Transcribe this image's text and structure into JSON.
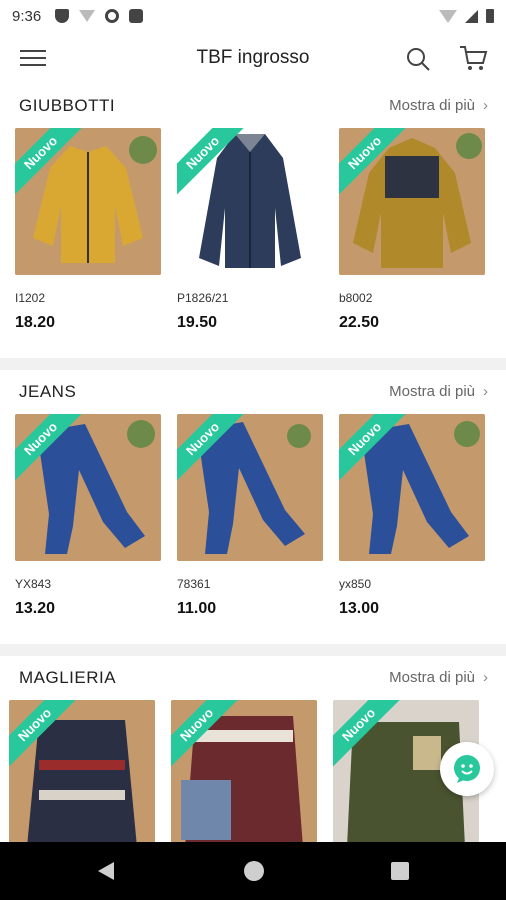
{
  "status_bar": {
    "time": "9:36"
  },
  "app_bar": {
    "title": "TBF ingrosso"
  },
  "sections": [
    {
      "title": "GIUBBOTTI",
      "more_label": "Mostra di più",
      "products": [
        {
          "badge": "Nuovo",
          "sku": "I1202",
          "price": "18.20",
          "color": "#d9a833",
          "bg": "#c49a6c"
        },
        {
          "badge": "Nuovo",
          "sku": "P1826/21",
          "price": "19.50",
          "color": "#2d3c5a",
          "bg": "#ffffff"
        },
        {
          "badge": "Nuovo",
          "sku": "b8002",
          "price": "22.50",
          "color": "#b08a2a",
          "bg": "#c49a6c"
        }
      ]
    },
    {
      "title": "JEANS",
      "more_label": "Mostra di più",
      "products": [
        {
          "badge": "Nuovo",
          "sku": "YX843",
          "price": "13.20",
          "color": "#2c4f9a",
          "bg": "#c49a6c"
        },
        {
          "badge": "Nuovo",
          "sku": "78361",
          "price": "11.00",
          "color": "#2c4f9a",
          "bg": "#c49a6c"
        },
        {
          "badge": "Nuovo",
          "sku": "yx850",
          "price": "13.00",
          "color": "#2c4f9a",
          "bg": "#c49a6c"
        }
      ]
    },
    {
      "title": "MAGLIERIA",
      "more_label": "Mostra di più",
      "products": [
        {
          "badge": "Nuovo",
          "sku": "",
          "price": "",
          "color": "#2b2f44",
          "bg": "#c49a6c"
        },
        {
          "badge": "Nuovo",
          "sku": "",
          "price": "",
          "color": "#6b2a2e",
          "bg": "#c49a6c"
        },
        {
          "badge": "Nuovo",
          "sku": "",
          "price": "",
          "color": "#49532f",
          "bg": "#d9d3cb"
        }
      ]
    }
  ],
  "icons": {
    "menu": "hamburger-icon",
    "search": "search-icon",
    "cart": "cart-icon",
    "chat": "chat-icon"
  },
  "colors": {
    "accent": "#28c79c"
  }
}
